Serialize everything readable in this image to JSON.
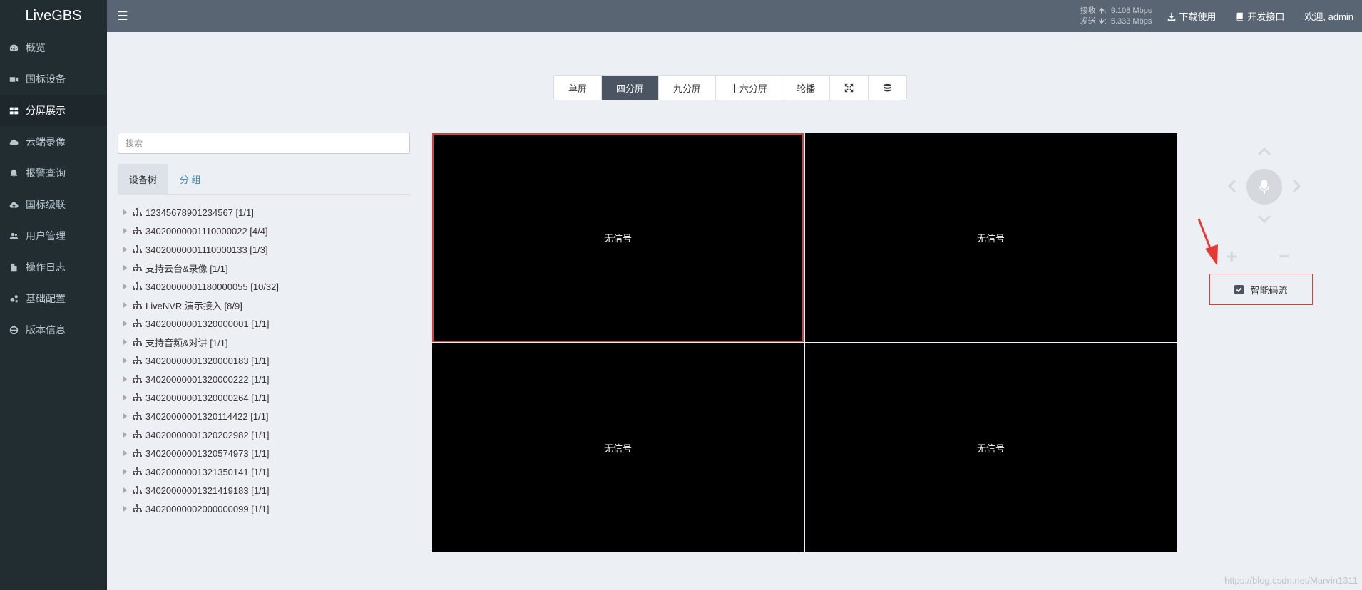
{
  "app": {
    "title": "LiveGBS"
  },
  "sidebar": {
    "items": [
      {
        "label": "概览",
        "icon": "dashboard-icon",
        "active": false
      },
      {
        "label": "国标设备",
        "icon": "video-camera-icon",
        "active": false
      },
      {
        "label": "分屏展示",
        "icon": "grid-icon",
        "active": true
      },
      {
        "label": "云端录像",
        "icon": "cloud-icon",
        "active": false
      },
      {
        "label": "报警查询",
        "icon": "bell-icon",
        "active": false
      },
      {
        "label": "国标级联",
        "icon": "cloud-upload-icon",
        "active": false
      },
      {
        "label": "用户管理",
        "icon": "users-icon",
        "active": false
      },
      {
        "label": "操作日志",
        "icon": "file-icon",
        "active": false
      },
      {
        "label": "基础配置",
        "icon": "gears-icon",
        "active": false
      },
      {
        "label": "版本信息",
        "icon": "globe-icon",
        "active": false
      }
    ]
  },
  "header": {
    "menu_icon": "hamburger-icon",
    "receive_label": "接收",
    "receive_value": "9.108 Mbps",
    "send_label": "发送",
    "send_value": "5.333 Mbps",
    "download_label": "下载使用",
    "api_label": "开发接口",
    "welcome": "欢迎, admin"
  },
  "toolbar": {
    "buttons": [
      {
        "label": "单屏",
        "active": false
      },
      {
        "label": "四分屏",
        "active": true
      },
      {
        "label": "九分屏",
        "active": false
      },
      {
        "label": "十六分屏",
        "active": false
      },
      {
        "label": "轮播",
        "active": false
      }
    ],
    "fullscreen_icon": "expand-icon",
    "storage_icon": "database-icon"
  },
  "search": {
    "placeholder": "搜索",
    "value": ""
  },
  "tabs": [
    {
      "label": "设备树",
      "active": true
    },
    {
      "label": "分 组",
      "active": false
    }
  ],
  "tree": [
    "12345678901234567 [1/1]",
    "34020000001110000022 [4/4]",
    "34020000001110000133 [1/3]",
    "支持云台&录像 [1/1]",
    "34020000001180000055 [10/32]",
    "LiveNVR 演示接入 [8/9]",
    "34020000001320000001 [1/1]",
    "支持音频&对讲 [1/1]",
    "34020000001320000183 [1/1]",
    "34020000001320000222 [1/1]",
    "34020000001320000264 [1/1]",
    "34020000001320114422 [1/1]",
    "34020000001320202982 [1/1]",
    "34020000001320574973 [1/1]",
    "34020000001321350141 [1/1]",
    "34020000001321419183 [1/1]",
    "34020000002000000099 [1/1]"
  ],
  "video": {
    "cells": [
      "无信号",
      "无信号",
      "无信号",
      "无信号"
    ],
    "selected_index": 0
  },
  "ptz": {
    "zoom_in": "+",
    "zoom_out": "−"
  },
  "smart_stream": {
    "label": "智能码流",
    "checked": true
  },
  "watermark": "https://blog.csdn.net/Marvin1311",
  "colors": {
    "sidebar": "#222d32",
    "header": "#5a6574",
    "accent": "#4b5562",
    "highlight": "#e53935"
  }
}
